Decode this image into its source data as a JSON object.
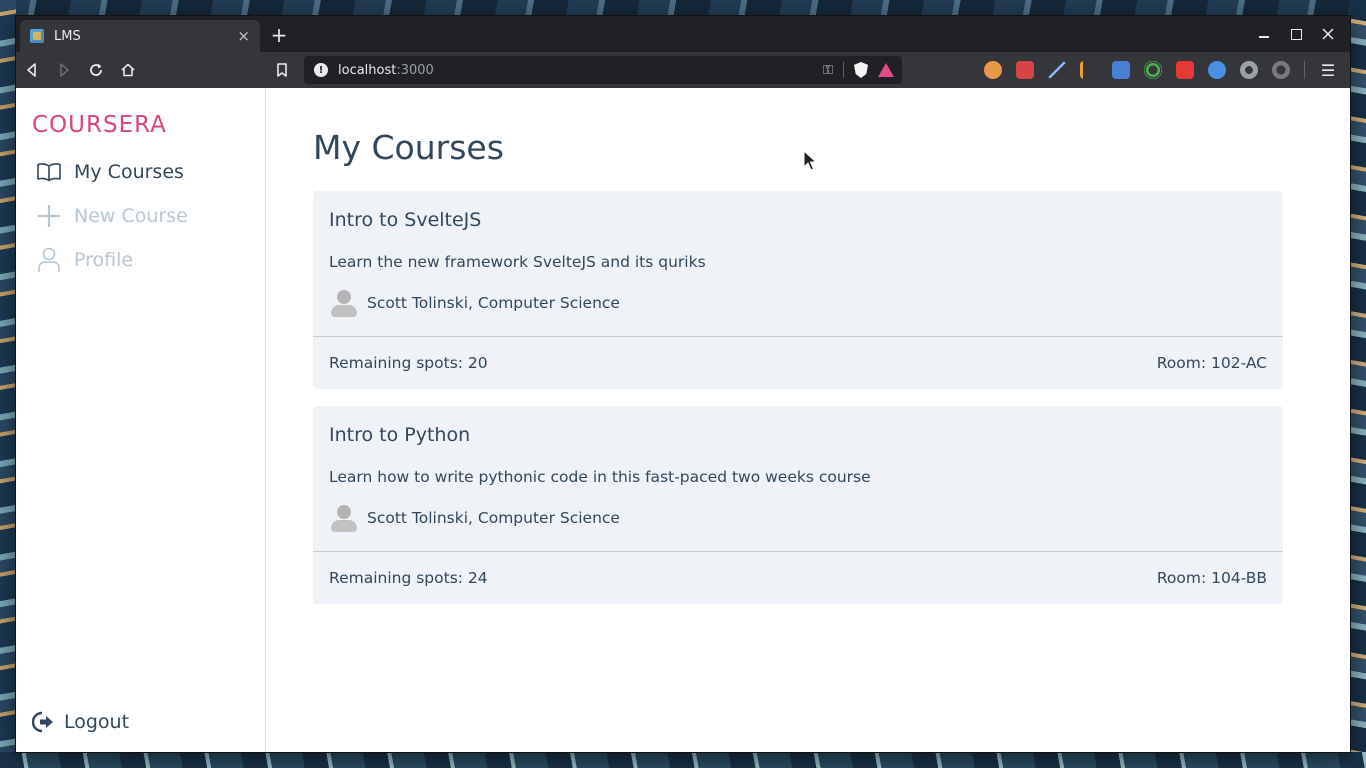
{
  "browser": {
    "tab_title": "LMS",
    "tab_close": "×",
    "new_tab": "+",
    "url_host": "localhost",
    "url_port": ":3000",
    "info_glyph": "!",
    "key_glyph": "⚿",
    "menu_glyph": "☰"
  },
  "sidebar": {
    "brand": "COURSERA",
    "brand_color": "#d6467f",
    "items": [
      {
        "label": "My Courses",
        "icon": "book-open-icon",
        "active": true
      },
      {
        "label": "New Course",
        "icon": "plus-icon",
        "active": false
      },
      {
        "label": "Profile",
        "icon": "user-icon",
        "active": false
      }
    ],
    "logout": {
      "label": "Logout",
      "icon": "logout-icon"
    }
  },
  "main": {
    "title": "My Courses",
    "courses": [
      {
        "title": "Intro to SvelteJS",
        "description": "Learn the new framework SvelteJS and its quriks",
        "instructor": "Scott Tolinski, Computer Science",
        "remaining": "Remaining spots: 20",
        "room": "Room: 102-AC"
      },
      {
        "title": "Intro to Python",
        "description": "Learn how to write pythonic code in this fast-paced two weeks course",
        "instructor": "Scott Tolinski, Computer Science",
        "remaining": "Remaining spots: 24",
        "room": "Room: 104-BB"
      }
    ]
  }
}
